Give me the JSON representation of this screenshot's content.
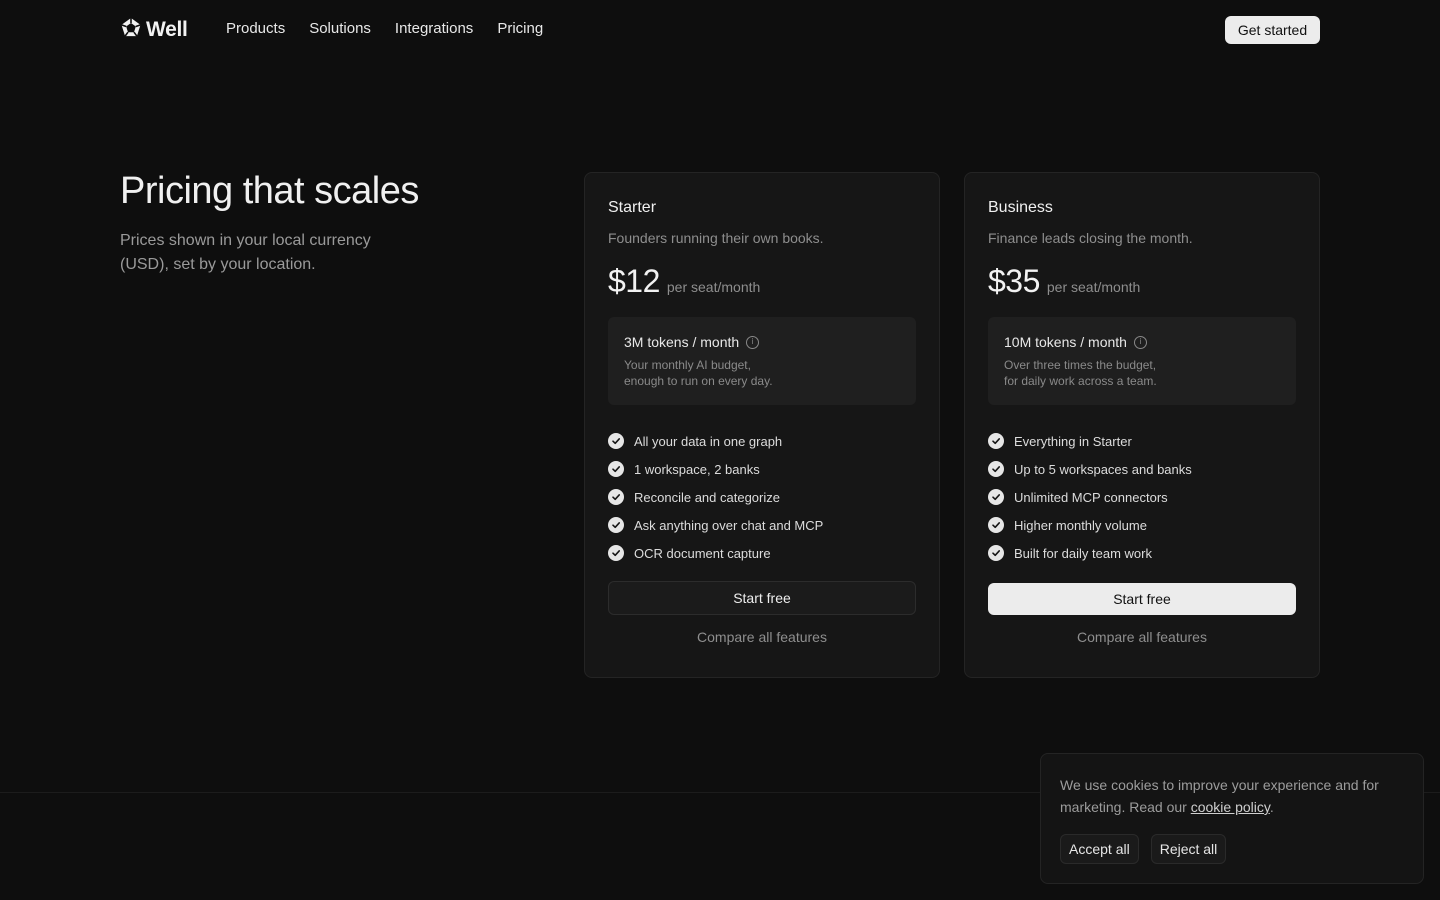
{
  "nav": {
    "logo_text": "Well",
    "links": [
      "Products",
      "Solutions",
      "Integrations",
      "Pricing"
    ],
    "cta": "Get started"
  },
  "hero": {
    "title": "Pricing that scales",
    "subtitle": "Prices shown in your local currency (USD), set by your location."
  },
  "plans": [
    {
      "name": "Starter",
      "description": "Founders running their own books.",
      "price": "$12",
      "unit": "per seat/month",
      "tokens_title": "3M tokens / month",
      "tokens_desc_line1": "Your monthly AI budget,",
      "tokens_desc_line2": "enough to run on every day.",
      "features": [
        "All your data in one graph",
        "1 workspace, 2 banks",
        "Reconcile and categorize",
        "Ask anything over chat and MCP",
        "OCR document capture"
      ],
      "button": "Start free",
      "compare": "Compare all features"
    },
    {
      "name": "Business",
      "description": "Finance leads closing the month.",
      "price": "$35",
      "unit": "per seat/month",
      "tokens_title": "10M tokens / month",
      "tokens_desc_line1": "Over three times the budget,",
      "tokens_desc_line2": "for daily work across a team.",
      "features": [
        "Everything in Starter",
        "Up to 5 workspaces and banks",
        "Unlimited MCP connectors",
        "Higher monthly volume",
        "Built for daily team work"
      ],
      "button": "Start free",
      "compare": "Compare all features"
    }
  ],
  "cookie": {
    "text": "We use cookies to improve your experience and for marketing. Read our",
    "link": "cookie policy",
    "suffix": ".",
    "accept": "Accept all",
    "reject": "Reject all"
  },
  "icons": {
    "logo": "well-logo-icon",
    "info": "info-icon",
    "check": "check-icon"
  },
  "colors": {
    "background": "#0e0e0e",
    "card": "#161616",
    "primary_button": "#ececec"
  }
}
